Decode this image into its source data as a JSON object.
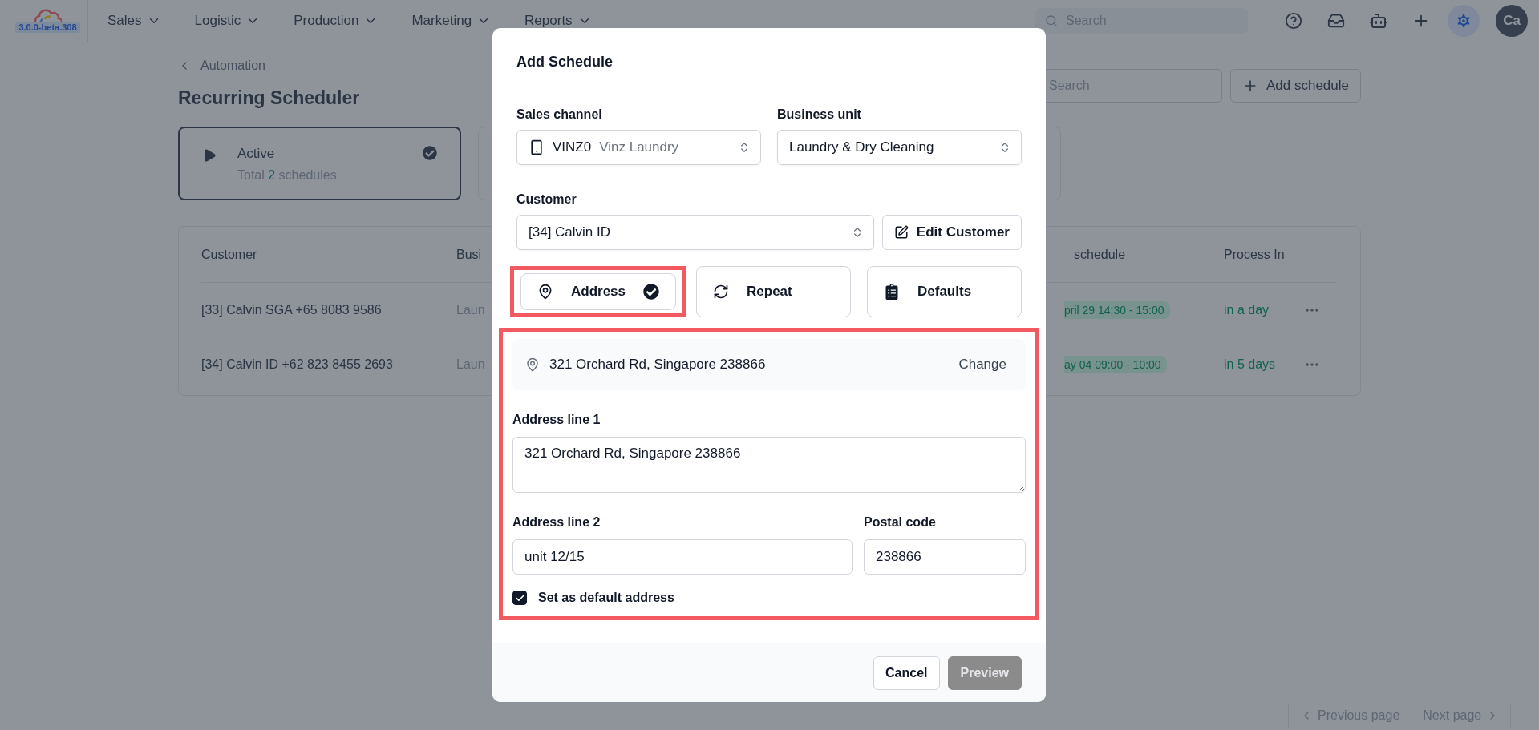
{
  "app": {
    "version": "3.0.0-beta.308"
  },
  "nav": {
    "menus": [
      {
        "label": "Sales"
      },
      {
        "label": "Logistic"
      },
      {
        "label": "Production"
      },
      {
        "label": "Marketing"
      },
      {
        "label": "Reports"
      }
    ],
    "search": {
      "placeholder": "Search"
    },
    "avatar": "Ca"
  },
  "page": {
    "breadcrumb": "Automation",
    "title": "Recurring Scheduler",
    "status_cards": [
      {
        "title": "Active",
        "count_prefix": "Total",
        "count": "2",
        "count_suffix": "schedules",
        "selected": true
      }
    ],
    "search": {
      "placeholder": "Search"
    },
    "add_button": "Add schedule",
    "table": {
      "columns": [
        "Customer",
        "Busi",
        "schedule",
        "Process In"
      ],
      "rows": [
        {
          "cells": [
            "[33] Calvin SGA +65 8083 9586",
            "Laun",
            "pril 29 14:30 - 15:00",
            "in a day"
          ]
        },
        {
          "cells": [
            "[34] Calvin ID +62 823 8455 2693",
            "Laun",
            "ay 04 09:00 - 10:00",
            "in 5 days"
          ]
        }
      ]
    },
    "pagination": {
      "previous": "Previous page",
      "next": "Next page"
    }
  },
  "dialog": {
    "title": "Add Schedule",
    "sales_channel": {
      "label": "Sales channel",
      "code": "VINZ0",
      "name": "Vinz Laundry"
    },
    "business_unit": {
      "label": "Business unit",
      "value": "Laundry & Dry Cleaning"
    },
    "customer": {
      "label": "Customer",
      "value": "[34] Calvin ID",
      "edit_button": "Edit Customer"
    },
    "sections": [
      {
        "label": "Address",
        "kind": "address",
        "complete": true,
        "highlighted": true
      },
      {
        "label": "Repeat",
        "kind": "repeat",
        "complete": false,
        "highlighted": false
      },
      {
        "label": "Defaults",
        "kind": "defaults",
        "complete": false,
        "highlighted": false
      }
    ],
    "address": {
      "highlighted": true,
      "summary": "321 Orchard Rd, Singapore 238866",
      "change_link": "Change",
      "line1": {
        "label": "Address line 1",
        "value": "321 Orchard Rd, Singapore 238866"
      },
      "line2": {
        "label": "Address line 2",
        "value": "unit 12/15"
      },
      "postal_code": {
        "label": "Postal code",
        "value": "238866"
      },
      "default": {
        "label": "Set as default address",
        "checked": true
      }
    },
    "buttons": [
      {
        "label": "Cancel",
        "kind": "secondary",
        "disabled": false
      },
      {
        "label": "Preview",
        "kind": "primary",
        "disabled": true
      }
    ]
  }
}
